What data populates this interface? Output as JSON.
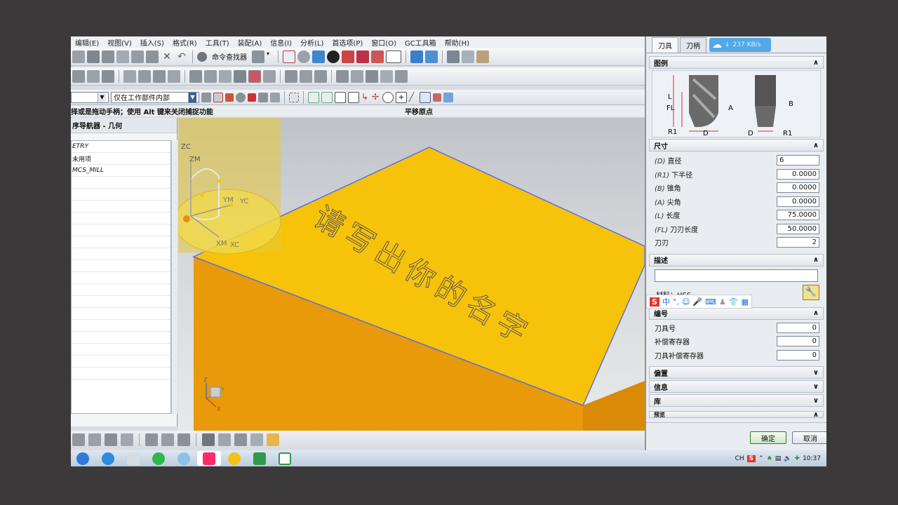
{
  "menu": [
    "编辑(E)",
    "视图(V)",
    "插入(S)",
    "格式(R)",
    "工具(T)",
    "装配(A)",
    "信息(I)",
    "分析(L)",
    "首选项(P)",
    "窗口(O)",
    "GC工具箱",
    "帮助(H)"
  ],
  "toolbar": {
    "command_finder_label": "命令查找器"
  },
  "filter": {
    "scope_value": "仅在工作部件内部"
  },
  "cue": {
    "left": "择或是拖动手柄；使用 Alt 键来关闭捕捉功能",
    "center": "平移原点"
  },
  "navigator": {
    "title": "序导航器 - 几何",
    "rows": [
      "ETRY",
      "未用项",
      "MCS_MILL"
    ]
  },
  "viewport": {
    "part_text": "请写出你的名字",
    "axis_labels": {
      "zc": "ZC",
      "zm": "ZM",
      "ym": "YM",
      "yc": "YC",
      "xm": "XM",
      "xc": "XC"
    },
    "triad": {
      "z": "Z",
      "y": "Y",
      "x": "X"
    },
    "colors": {
      "part_top": "#f7c30a",
      "part_side": "#e89a0b",
      "part_edge": "#5b6ee0",
      "mcs_cylinder": "#e8c838"
    }
  },
  "dialog": {
    "tabs": [
      "刀具",
      "刀柄"
    ],
    "net_speed": "237 KB/s",
    "sections": {
      "legend": "图例",
      "dimensions": "尺寸",
      "description": "描述",
      "numbering": "编号",
      "offset": "偏置",
      "info": "信息",
      "library": "库",
      "preview": "预览"
    },
    "legend_labels": {
      "L": "L",
      "FL": "FL",
      "A": "A",
      "R1a": "R1",
      "Da": "D",
      "B": "B",
      "Db": "D",
      "R1b": "R1"
    },
    "params": [
      {
        "code": "(D)",
        "label": "直径",
        "value": "6"
      },
      {
        "code": "(R1)",
        "label": "下半径",
        "value": "0.0000"
      },
      {
        "code": "(B)",
        "label": "锥角",
        "value": "0.0000"
      },
      {
        "code": "(A)",
        "label": "尖角",
        "value": "0.0000"
      },
      {
        "code": "(L)",
        "label": "长度",
        "value": "75.0000"
      },
      {
        "code": "(FL)",
        "label": "刀刃长度",
        "value": "50.0000"
      }
    ],
    "flutes": {
      "label": "刀刃",
      "value": "2"
    },
    "material": "材料：HSS",
    "numbering": [
      {
        "label": "刀具号",
        "value": "0"
      },
      {
        "label": "补偿寄存器",
        "value": "0"
      },
      {
        "label": "刀具补偿寄存器",
        "value": "0"
      }
    ],
    "ok_label": "确定",
    "cancel_label": "取消"
  },
  "ime": {
    "logo": "S",
    "mode": "中"
  },
  "tray": {
    "lang": "CH",
    "time": "10:37"
  }
}
